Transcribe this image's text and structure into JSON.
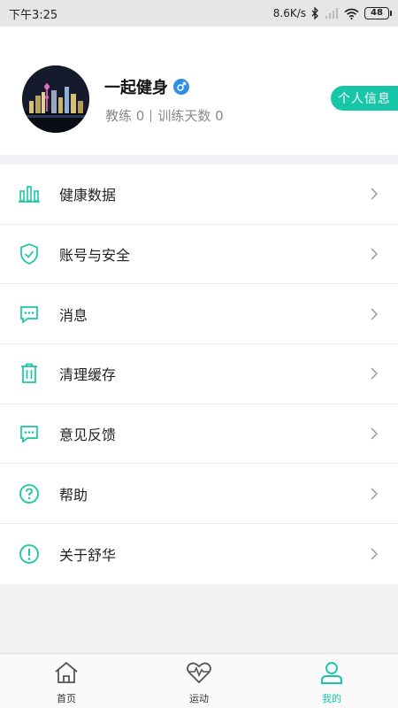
{
  "status_bar": {
    "time": "下午3:25",
    "network_speed": "8.6K/s",
    "battery": "48"
  },
  "profile": {
    "name": "一起健身",
    "gender_icon": "male-icon",
    "coach_stat": "教练 0",
    "training_stat": "训练天数 0",
    "personal_info_label": "个人信息"
  },
  "menu": {
    "items": [
      {
        "label": "健康数据",
        "icon": "bar-chart-icon"
      },
      {
        "label": "账号与安全",
        "icon": "shield-check-icon"
      },
      {
        "label": "消息",
        "icon": "message-icon"
      },
      {
        "label": "清理缓存",
        "icon": "trash-icon"
      },
      {
        "label": "意见反馈",
        "icon": "feedback-icon"
      },
      {
        "label": "帮助",
        "icon": "help-icon"
      },
      {
        "label": "关于舒华",
        "icon": "info-icon"
      }
    ]
  },
  "tab_bar": {
    "tabs": [
      {
        "label": "首页",
        "icon": "home-icon",
        "active": false
      },
      {
        "label": "运动",
        "icon": "heartbeat-icon",
        "active": false
      },
      {
        "label": "我的",
        "icon": "user-icon",
        "active": true
      }
    ]
  },
  "colors": {
    "accent": "#17c6a6",
    "gender_blue": "#2e8fe6",
    "background": "#f2f2f4"
  }
}
